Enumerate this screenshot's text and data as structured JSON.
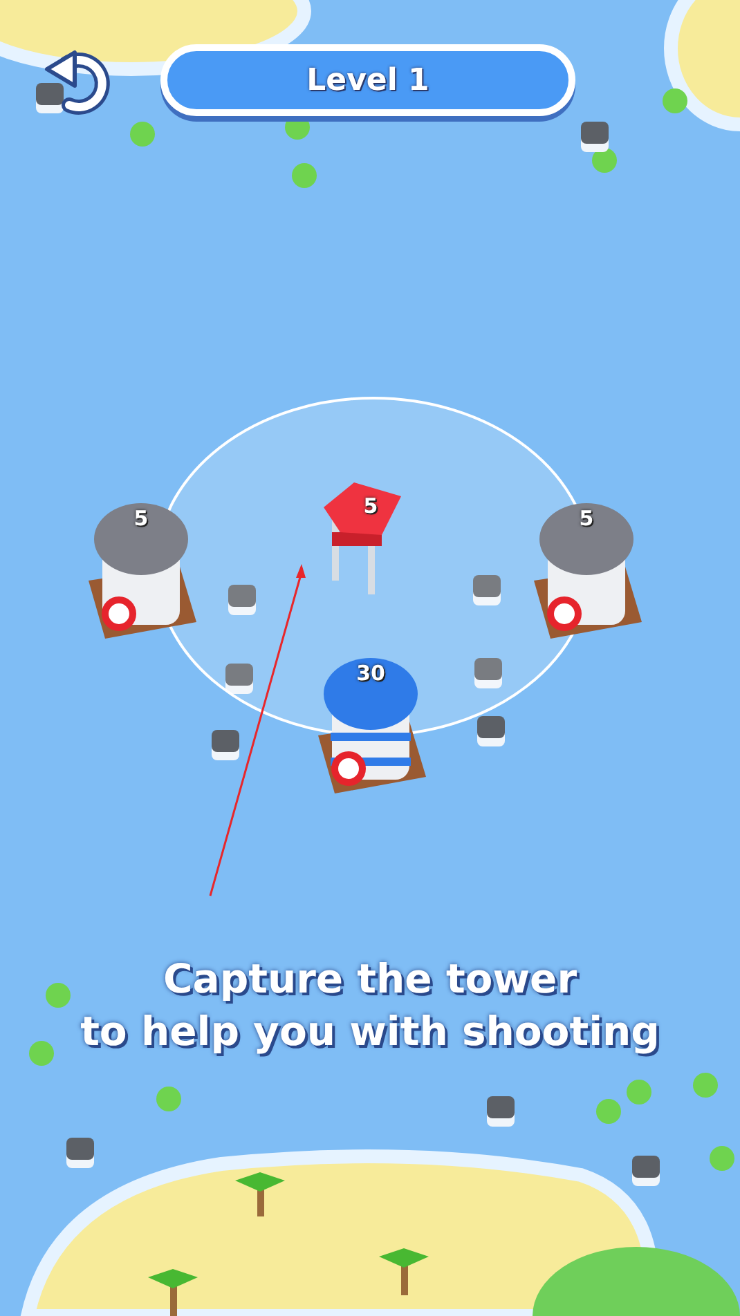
{
  "level_title": "Level 1",
  "towers": [
    {
      "kind": "neutral",
      "count": "5"
    },
    {
      "kind": "enemy",
      "count": "5"
    },
    {
      "kind": "neutral",
      "count": "5"
    },
    {
      "kind": "player",
      "count": "30"
    }
  ],
  "hint": "Capture the tower\nto help you with shooting"
}
